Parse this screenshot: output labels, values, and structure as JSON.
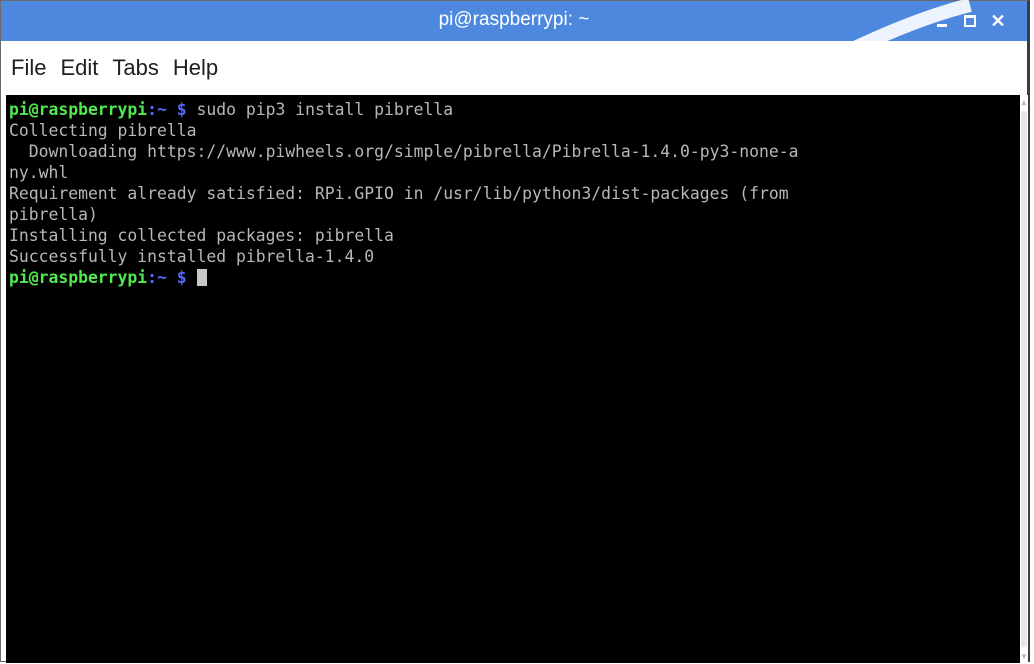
{
  "window": {
    "title": "pi@raspberrypi: ~",
    "controls": {
      "minimize_icon": "minimize-icon",
      "maximize_icon": "maximize-icon",
      "close_icon": "close-icon"
    },
    "titlebar_color": "#4d88de"
  },
  "menubar": {
    "items": [
      "File",
      "Edit",
      "Tabs",
      "Help"
    ]
  },
  "terminal": {
    "prompt_user": "pi@raspberrypi",
    "prompt_path": ":~",
    "prompt_sign": "$",
    "command": "sudo pip3 install pibrella",
    "output": [
      "Collecting pibrella",
      "  Downloading https://www.piwheels.org/simple/pibrella/Pibrella-1.4.0-py3-none-a",
      "ny.whl",
      "Requirement already satisfied: RPi.GPIO in /usr/lib/python3/dist-packages (from",
      "pibrella)",
      "Installing collected packages: pibrella",
      "Successfully installed pibrella-1.4.0"
    ],
    "colors": {
      "background": "#000000",
      "text": "#b7b7b7",
      "prompt_user": "#52e84f",
      "prompt_path": "#5468ff"
    }
  }
}
